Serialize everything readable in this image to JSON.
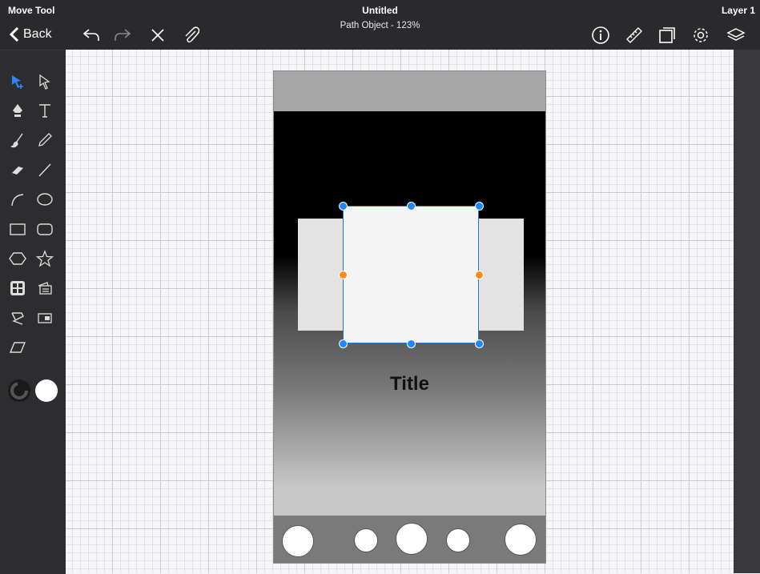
{
  "app": {
    "tool_name": "Move Tool",
    "document_title": "Untitled",
    "document_subtitle": "Path Object - 123%",
    "layer_name": "Layer 1",
    "back_label": "Back"
  },
  "toolbar_left": [
    "undo-icon",
    "redo-icon",
    "close-icon",
    "attachment-icon"
  ],
  "toolbar_right": [
    "info-icon",
    "ruler-icon",
    "artboard-icon",
    "gear-icon",
    "layers-icon"
  ],
  "tools": [
    "selection-tool-icon",
    "direct-selection-tool-icon",
    "pen-tool-icon",
    "text-tool-icon",
    "brush-tool-icon",
    "pencil-tool-icon",
    "eraser-tool-icon",
    "line-tool-icon",
    "arc-tool-icon",
    "ellipse-tool-icon",
    "rectangle-tool-icon",
    "rounded-rectangle-tool-icon",
    "polygon-tool-icon",
    "star-tool-icon",
    "grid-tool-icon",
    "image-tool-icon",
    "path-transform-tool-icon",
    "crop-tool-icon",
    "skew-tool-icon"
  ],
  "colors": {
    "stroke": "#1a1a1a",
    "fill": "#ffffff",
    "selection": "#1e88ff",
    "midpoint_handle": "#ff8c1a"
  },
  "artboard": {
    "title": "Title"
  }
}
